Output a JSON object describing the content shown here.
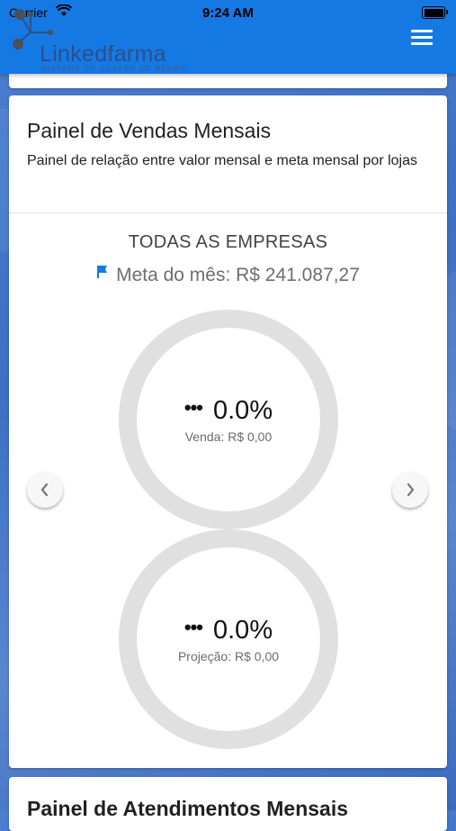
{
  "status_bar": {
    "carrier": "Carrier",
    "time": "9:24 AM"
  },
  "header": {
    "app_name": "Linkedfarma",
    "tagline": "SISTEMA DE GESTÃO DE REDES",
    "brand_color": "#1479e3"
  },
  "sales_panel": {
    "title": "Painel de Vendas Mensais",
    "description": "Painel de relação entre valor mensal e meta mensal por lojas",
    "company": "TODAS AS EMPRESAS",
    "goal_label": "Meta do mês: R$ 241.087,27",
    "sales_gauge": {
      "percent": "0.0%",
      "label": "Venda: R$ 0,00"
    },
    "projection_gauge": {
      "percent": "0.0%",
      "label": "Projeção: R$ 0,00"
    }
  },
  "next_panel": {
    "title": "Painel de Atendimentos Mensais"
  },
  "icons": {
    "menu": "hamburger-icon",
    "prev": "chevron-left-icon",
    "next": "chevron-right-icon",
    "goal": "flag-icon",
    "more": "more-dots-icon"
  }
}
